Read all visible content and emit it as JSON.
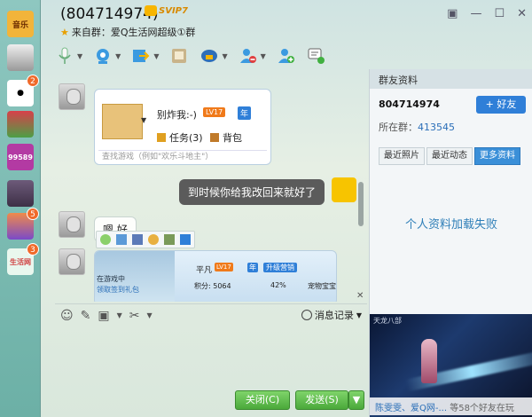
{
  "window": {
    "title": "(804714974)",
    "vip_badge": "SVIP7",
    "from_group": "来自群：爱Q生活网超级①群"
  },
  "sidebar": {
    "items": [
      {
        "label": "音乐",
        "badge": ""
      },
      {
        "label": "",
        "badge": ""
      },
      {
        "label": "",
        "badge": "2"
      },
      {
        "label": "",
        "badge": ""
      },
      {
        "label": "99589",
        "badge": ""
      },
      {
        "label": "",
        "badge": ""
      },
      {
        "label": "",
        "badge": "5"
      },
      {
        "label": "生活网",
        "badge": "3"
      }
    ]
  },
  "chat": {
    "game_card": {
      "nickname": "别炸我:-)",
      "level": "LV17",
      "rank": "年",
      "task": "任务(3)",
      "bag": "背包",
      "search_placeholder": "查找游戏（例如\"欢乐斗地主\"）"
    },
    "sent_message": "到时候你给我改回来就好了",
    "received_message": "嗯 好",
    "game_card2": {
      "label_player": "平凡",
      "level": "LV17",
      "rank": "年",
      "upgrade": "升级营销",
      "score": "积分: 5064",
      "percent": "42%",
      "treasure": "宠物宝宝",
      "in_game": "在游戏中",
      "gift": "领取签到礼包"
    }
  },
  "input_toolbar": {
    "history": "消息记录"
  },
  "buttons": {
    "close": "关闭(C)",
    "send": "发送(S)"
  },
  "right_panel": {
    "title": "群友资料",
    "qq_id": "804714974",
    "add_friend": "+ 好友",
    "group_label": "所在群：",
    "group_id": "413545",
    "tabs": [
      "最近照片",
      "最近动态",
      "更多资料"
    ],
    "load_failed": "个人资料加载失败",
    "ad_caption_link": "陈雯雯、爱Q网-...",
    "ad_caption_sub": "等58个好友在玩",
    "ad_watermark": "天龙八部"
  },
  "colors": {
    "accent_blue": "#2f7fd8",
    "send_green": "#4aa93a",
    "badge_orange": "#f06a2a"
  }
}
